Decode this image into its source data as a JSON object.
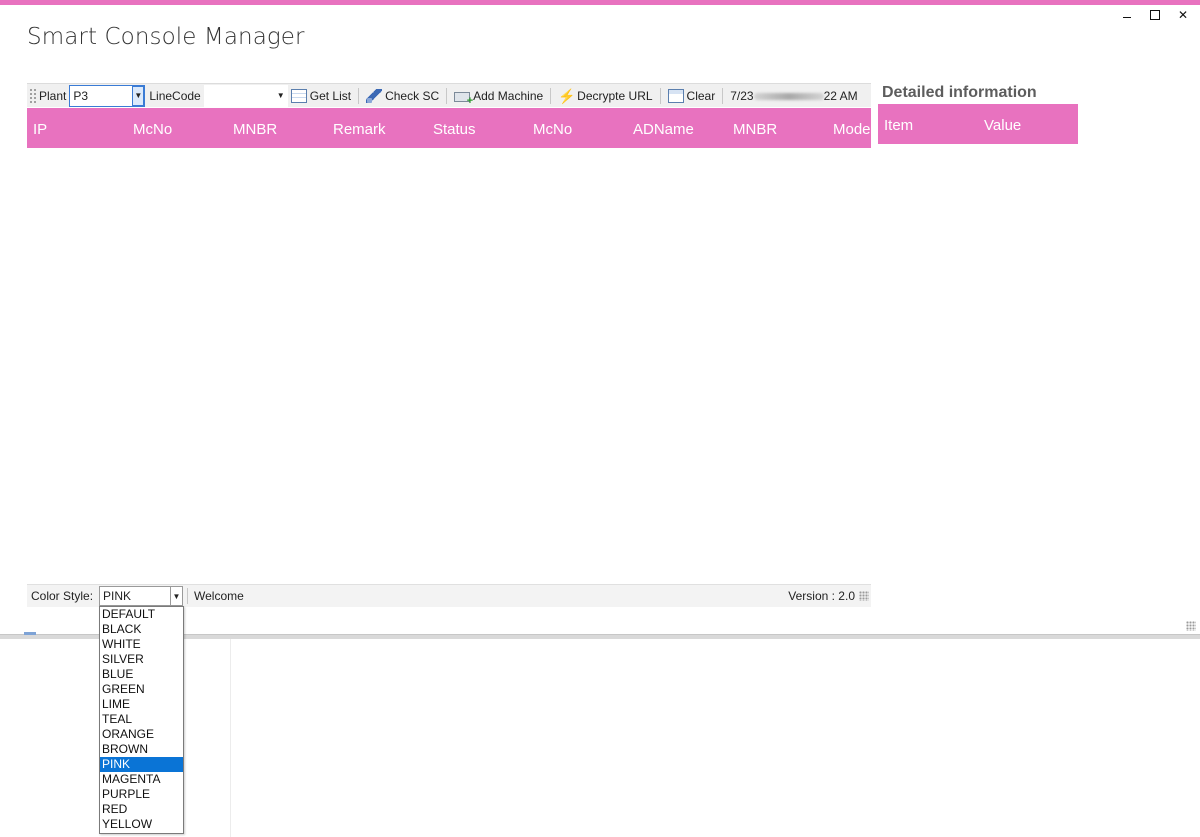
{
  "app": {
    "title": "Smart Console Manager",
    "accent_color": "#e872bf"
  },
  "window_controls": {
    "minimize": "minimize-icon",
    "maximize": "maximize-icon",
    "close": "close-icon"
  },
  "toolbar": {
    "plant_label": "Plant",
    "plant_value": "P3",
    "linecode_label": "LineCode",
    "linecode_value": "",
    "get_list": "Get List",
    "check_sc": "Check SC",
    "add_machine": "Add Machine",
    "decrypt_url": "Decrypte URL",
    "clear": "Clear",
    "timestamp_prefix": "7/23",
    "timestamp_suffix": "22 AM"
  },
  "grid": {
    "columns": [
      "IP",
      "McNo",
      "MNBR",
      "Remark",
      "Status",
      "McNo",
      "ADName",
      "MNBR",
      "Mode"
    ]
  },
  "detail": {
    "title": "Detailed information",
    "columns": [
      "Item",
      "Value"
    ]
  },
  "statusbar": {
    "color_style_label": "Color Style:",
    "color_style_value": "PINK",
    "message": "Welcome",
    "version": "Version : 2.0"
  },
  "color_options": [
    "DEFAULT",
    "BLACK",
    "WHITE",
    "SILVER",
    "BLUE",
    "GREEN",
    "LIME",
    "TEAL",
    "ORANGE",
    "BROWN",
    "PINK",
    "MAGENTA",
    "PURPLE",
    "RED",
    "YELLOW"
  ],
  "selected_color_index": 10
}
